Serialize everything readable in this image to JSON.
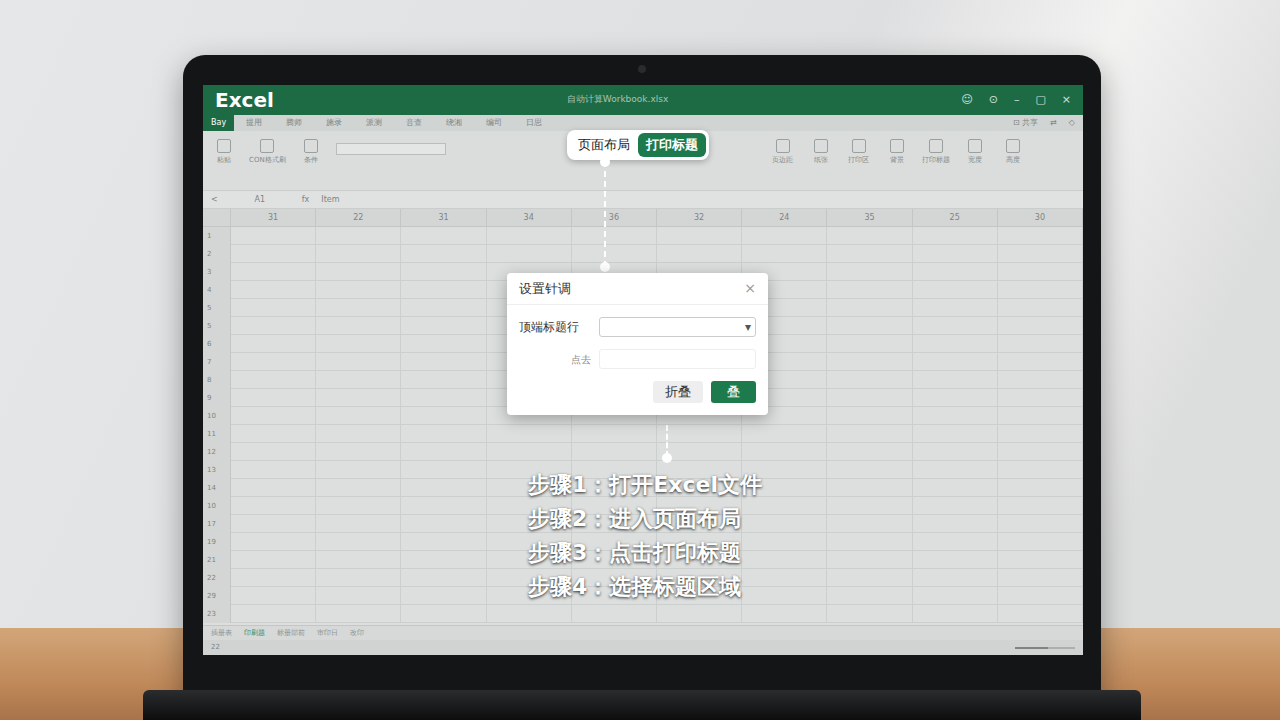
{
  "app": {
    "logo": "Excel",
    "title": "自动计算Workbook.xlsx",
    "window_buttons": [
      "☺",
      "⊙",
      "–",
      "▢",
      "×"
    ]
  },
  "ribbon_tabs": [
    {
      "label": "Bay",
      "selected": true
    },
    {
      "label": "提用",
      "selected": false
    },
    {
      "label": "腾师",
      "selected": false
    },
    {
      "label": "施录",
      "selected": false
    },
    {
      "label": "派测",
      "selected": false
    },
    {
      "label": "音查",
      "selected": false
    },
    {
      "label": "绕湘",
      "selected": false
    },
    {
      "label": "编司",
      "selected": false
    },
    {
      "label": "日思",
      "selected": false
    }
  ],
  "ribbon_right": [
    "⊡ 共享",
    "⇄",
    "◇"
  ],
  "ribbon_buttons_left": [
    "粘贴",
    "CON格式刷",
    "条件"
  ],
  "ribbon_buttons_right": [
    "页边距",
    "纸张",
    "打印区",
    "背景",
    "打印标题",
    "宽度",
    "高度"
  ],
  "formula_bar": {
    "back": "<",
    "cell": "A1",
    "fx": "fx",
    "value": "Item"
  },
  "grid": {
    "columns": [
      "31",
      "22",
      "31",
      "34",
      "36",
      "32",
      "24",
      "35",
      "25",
      "30"
    ],
    "rows": [
      "1",
      "2",
      "3",
      "4",
      "5",
      "5",
      "6",
      "7",
      "8",
      "9",
      "10",
      "11",
      "12",
      "13",
      "14",
      "10",
      "17",
      "19",
      "21",
      "22",
      "29",
      "23"
    ]
  },
  "sheet_tabs": [
    {
      "label": "插册表",
      "selected": false
    },
    {
      "label": "印刷题",
      "selected": true
    },
    {
      "label": "标册部前",
      "selected": false
    },
    {
      "label": "审印日",
      "selected": false
    },
    {
      "label": "改印",
      "selected": false
    }
  ],
  "status_bar": {
    "left": "22",
    "zoom_level": 0.55
  },
  "callout": {
    "menu": "页面布局",
    "command": "打印标题"
  },
  "dialog": {
    "title": "设置针调",
    "close": "×",
    "fields": [
      {
        "label": "顶端标题行",
        "kind": "select",
        "arrow": "▾"
      },
      {
        "label": "点去",
        "kind": "input"
      }
    ],
    "buttons": [
      {
        "label": "折叠",
        "primary": false
      },
      {
        "label": "叠",
        "primary": true
      }
    ]
  },
  "steps": [
    "步骤1：打开Excel文件",
    "步骤2：进入页面布局",
    "步骤3：点击打印标题",
    "步骤4：选择标题区域"
  ]
}
